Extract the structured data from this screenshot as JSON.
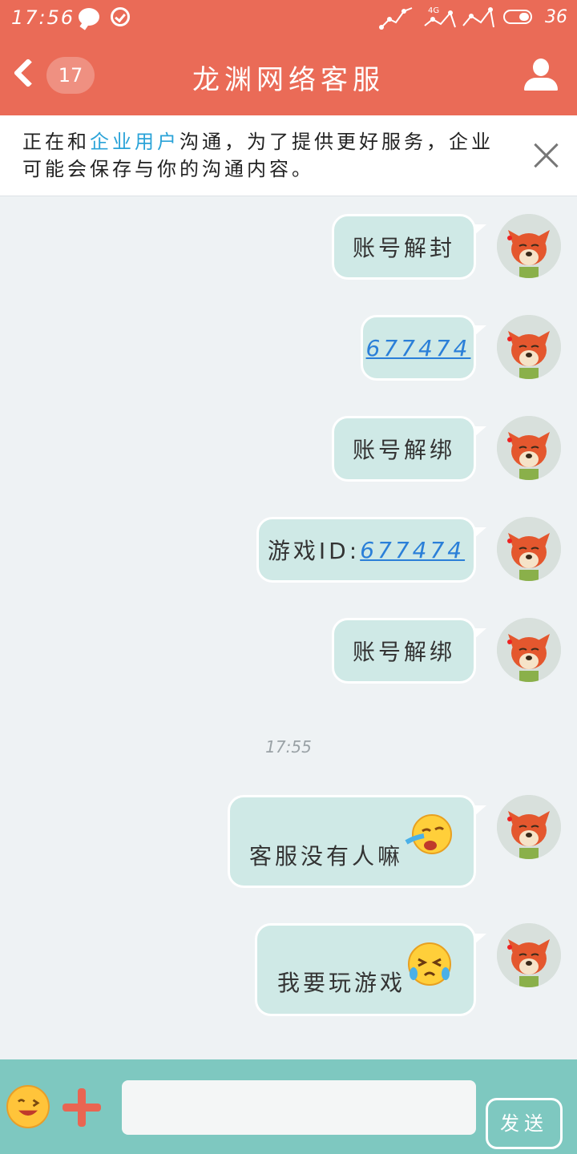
{
  "status": {
    "time": "17:56",
    "network": "4G",
    "battery": "36"
  },
  "header": {
    "back_badge": "17",
    "title": "龙渊网络客服"
  },
  "notice": {
    "prefix": "正在和",
    "highlight": "企业用户",
    "suffix": "沟通，为了提供更好服务，企业可能会保存与你的沟通内容。"
  },
  "messages": [
    {
      "text": "账号解封"
    },
    {
      "link": "677474"
    },
    {
      "text": "账号解绑"
    },
    {
      "label": "游戏ID:",
      "link": "677474"
    },
    {
      "text": "账号解绑"
    },
    {
      "text": "客服没有人嘛"
    },
    {
      "text": "我要玩游戏"
    }
  ],
  "timestamp": "17:55",
  "input": {
    "send_label": "发送"
  },
  "colors": {
    "header": "#ea6b57",
    "bubble": "#cfe9e6",
    "input_bar": "#7ec8c0",
    "link": "#2a7fd8"
  }
}
